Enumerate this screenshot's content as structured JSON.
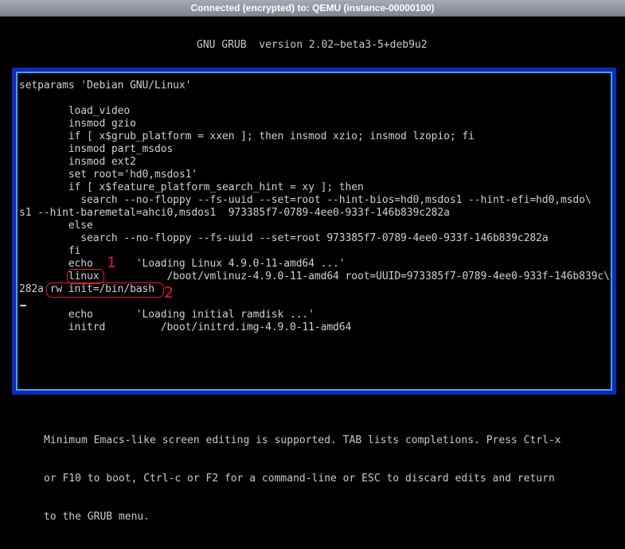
{
  "window": {
    "title": "Connected (encrypted) to: QEMU (instance-00000100)"
  },
  "grub": {
    "header": "GNU GRUB  version 2.02~beta3-5+deb9u2"
  },
  "editor": {
    "lines": [
      "setparams 'Debian GNU/Linux'",
      "",
      "        load_video",
      "        insmod gzio",
      "        if [ x$grub_platform = xxen ]; then insmod xzio; insmod lzopio; fi",
      "        insmod part_msdos",
      "        insmod ext2",
      "        set root='hd0,msdos1'",
      "        if [ x$feature_platform_search_hint = xy ]; then",
      "          search --no-floppy --fs-uuid --set=root --hint-bios=hd0,msdos1 --hint-efi=hd0,msdo\\",
      "s1 --hint-baremetal=ahci0,msdos1  973385f7-0789-4ee0-933f-146b839c282a",
      "        else",
      "          search --no-floppy --fs-uuid --set=root 973385f7-0789-4ee0-933f-146b839c282a",
      "        fi",
      "        echo       'Loading Linux 4.9.0-11-amd64 ...'",
      "        linux           /boot/vmlinuz-4.9.0-11-amd64 root=UUID=973385f7-0789-4ee0-933f-146b839c\\",
      "282a rw init=/bin/bash",
      "",
      "        echo       'Loading initial ramdisk ...'",
      "        initrd         /boot/initrd.img-4.9.0-11-amd64"
    ]
  },
  "annotations": [
    {
      "label": "1",
      "target": "linux"
    },
    {
      "label": "2",
      "target": "rw init=/bin/bash"
    }
  ],
  "help": {
    "lines": [
      "Minimum Emacs-like screen editing is supported. TAB lists completions. Press Ctrl-x",
      "or F10 to boot, Ctrl-c or F2 for a command-line or ESC to discard edits and return",
      "to the GRUB menu."
    ]
  }
}
